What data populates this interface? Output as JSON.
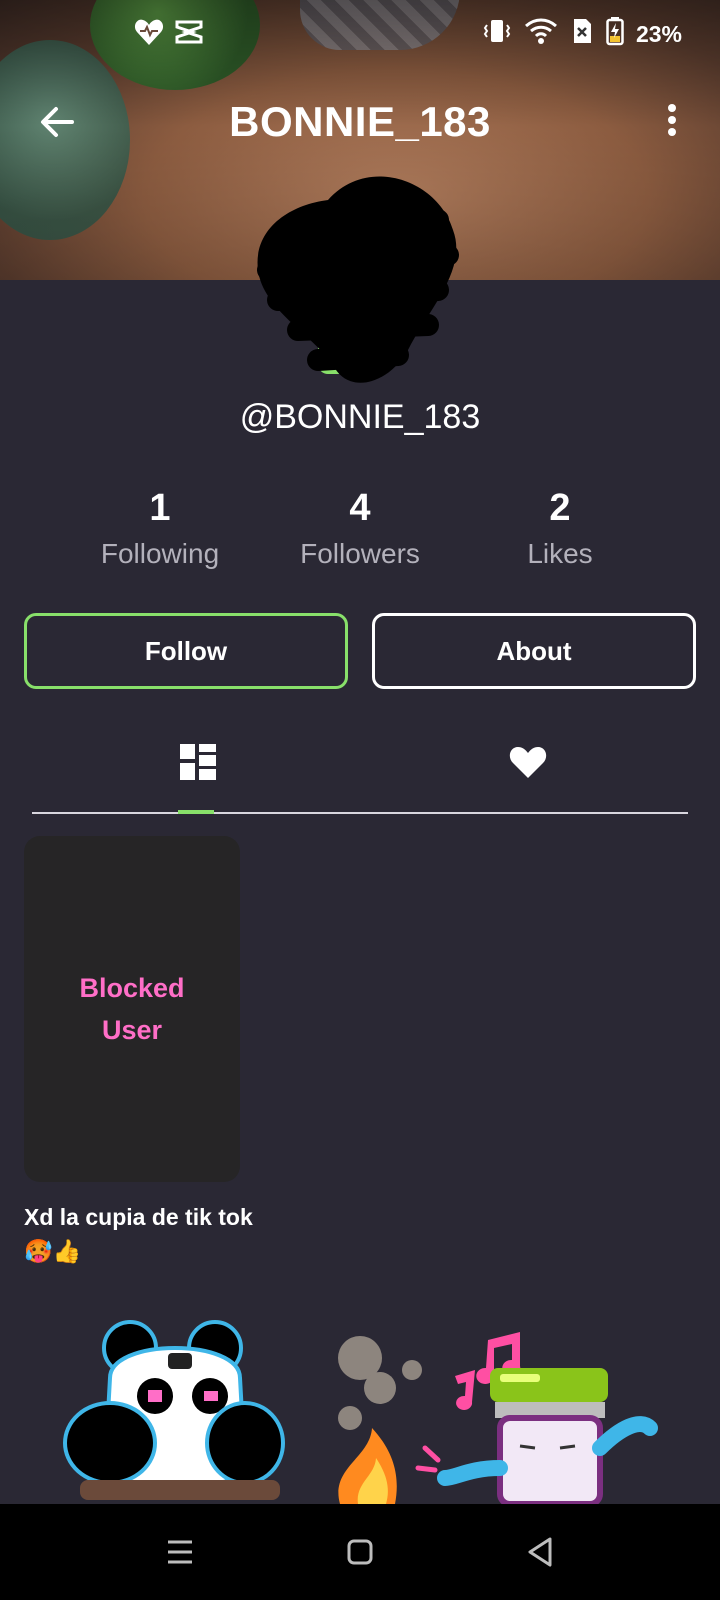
{
  "status_bar": {
    "battery": "23%",
    "left_icons": [
      "heart-icon",
      "capcut-icon"
    ],
    "right_icons": [
      "vibrate-icon",
      "wifi-icon",
      "no-sim-icon",
      "battery-charging-icon"
    ]
  },
  "header": {
    "title": "BONNIE_183",
    "back_icon": "arrow-left-icon",
    "menu_icon": "more-vertical-icon"
  },
  "profile": {
    "handle": "@BONNIE_183"
  },
  "stats": [
    {
      "value": "1",
      "label": "Following"
    },
    {
      "value": "4",
      "label": "Followers"
    },
    {
      "value": "2",
      "label": "Likes"
    }
  ],
  "actions": {
    "follow_label": "Follow",
    "about_label": "About"
  },
  "tabs": [
    {
      "icon": "grid-icon",
      "active": true
    },
    {
      "icon": "heart-icon",
      "active": false
    }
  ],
  "posts": [
    {
      "overlay": "Blocked User",
      "caption": "Xd la cupia de tik tok 🥵👍"
    }
  ],
  "colors": {
    "background": "#2a2834",
    "accent_green": "#88e06a",
    "blocked_pink": "#ff6ec7",
    "card": "#262526"
  }
}
